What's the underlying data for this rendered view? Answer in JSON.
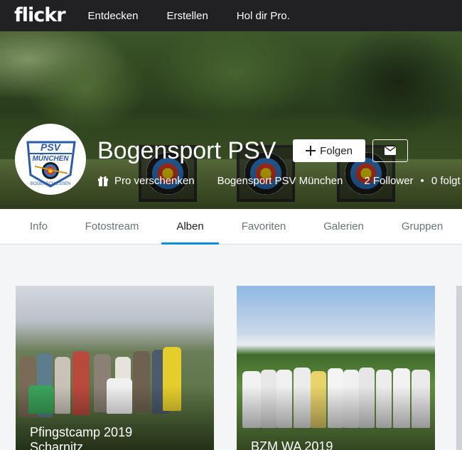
{
  "nav": {
    "logo": "flickr",
    "links": [
      "Entdecken",
      "Erstellen",
      "Hol dir Pro."
    ]
  },
  "profile": {
    "name": "Bogensport PSV",
    "follow_label": "Folgen",
    "pro_gift_label": "Pro verschenken",
    "full_name": "Bogensport PSV München",
    "followers": "2 Follower",
    "following": "0 folgt",
    "avatar_logo": {
      "line1": "PSV",
      "line2": "MÜNCHEN",
      "line3": "BOGENSCHIESSEN"
    }
  },
  "tabs": [
    "Info",
    "Fotostream",
    "Alben",
    "Favoriten",
    "Galerien",
    "Gruppen"
  ],
  "active_tab": "Alben",
  "albums": [
    {
      "title_line1": "Pfingstcamp 2019",
      "title_line2": "Scharnitz"
    },
    {
      "title_line1": "BZM WA 2019"
    }
  ],
  "colors": {
    "nav_bg": "#212124",
    "accent": "#128fdc",
    "page_bg": "#f3f5f6"
  }
}
